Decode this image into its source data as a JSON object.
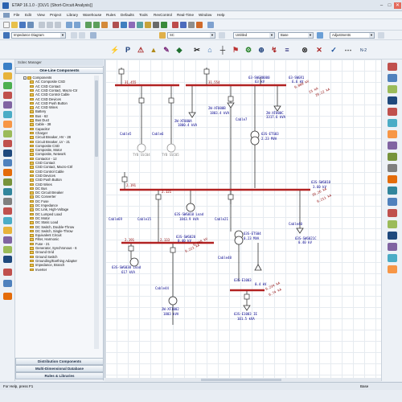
{
  "window": {
    "title": "ETAP 16.1.0 - [OLV1 (Short-Circuit Analysis)]",
    "minimize": "–",
    "maximize": "□",
    "close": "✕"
  },
  "menu": [
    "File",
    "Edit",
    "View",
    "Project",
    "Library",
    "Warehouse",
    "Rules",
    "Defaults",
    "Tools",
    "RevControl",
    "Real-Time",
    "Window",
    "Help"
  ],
  "toolbar": {
    "mode_combo": "Impedance Diagram",
    "study_case_combo": "SC",
    "revision_combo": "Untitled",
    "config_combo": "Base",
    "adjustments_combo": "Adjustments",
    "n2_label": "N-2"
  },
  "panel": {
    "title": "Scitec Manager",
    "header": "One-Line Components",
    "tree_items": [
      "Components",
      "AC Composite CSD",
      "AC CSD Contact",
      "AC CSD Contact, Macro-Ctr",
      "AC CSD Control Cable",
      "AC CSD Devices",
      "AC CSD Push Button",
      "AC CSD Wires",
      "Battery",
      "Bus - 62",
      "Bus Duct",
      "Cable - 38",
      "Capacitor",
      "Charger",
      "Circuit Breaker, HV - 28",
      "Circuit Breaker, LV - 21",
      "Composite CSD",
      "Composite, Motor",
      "Composite, Network",
      "Contactor - 12",
      "CSD Contact",
      "CSD Contact, Macro-Ctrl",
      "CSD Control Cable",
      "CSD Devices",
      "CSD Push Button",
      "CSD Wires",
      "DC Bus",
      "DC Circuit Breaker",
      "DC Converter",
      "DC Fuse",
      "DC Impedance",
      "DC Link, High-Voltage",
      "DC Lumped Load",
      "DC Motor",
      "DC Static Load",
      "DC Switch, Double-Throw",
      "DC Switch, Single-Throw",
      "Equivalent Circuit",
      "Filter, Harmonic",
      "Fuse - 21",
      "Generator, Synchronous - 6",
      "Ground Grid",
      "Ground Switch",
      "Grounding/Earthing Adapter",
      "Impedance, Branch",
      "Inverter"
    ],
    "bottom_buttons": [
      "Distribution Components",
      "Multi-Dimensional Database",
      "Rules & Libraries"
    ]
  },
  "diagram": {
    "labels": [
      {
        "text": "31,455",
        "color": "#8b0000"
      },
      {
        "text": "31,554",
        "color": "#8b0000"
      },
      {
        "text": "63-SWGR0000",
        "color": "#00008b"
      },
      {
        "text": "63 kV",
        "color": "#00008b"
      },
      {
        "text": "63-SWGR1",
        "color": "#00008b"
      },
      {
        "text": "6.6 kV",
        "color": "#00008b"
      },
      {
        "text": "0.000 kV",
        "color": "#8b0000"
      },
      {
        "text": "23 kA",
        "color": "#8b0000"
      },
      {
        "text": "20.22 kA",
        "color": "#8b0000"
      },
      {
        "text": "2W-XF000A",
        "color": "#00008b"
      },
      {
        "text": "2W-XF000B",
        "color": "#00008b"
      },
      {
        "text": "2W-XF000C",
        "color": "#00008b"
      },
      {
        "text": "1800.4 kVA",
        "color": "#00008b"
      },
      {
        "text": "1803.4 kVA",
        "color": "#00008b"
      },
      {
        "text": "3317.6 kVA",
        "color": "#00008b"
      },
      {
        "text": "Cable7",
        "color": "#00008b"
      },
      {
        "text": "Cable5",
        "color": "#00008b"
      },
      {
        "text": "Cable6",
        "color": "#00008b"
      },
      {
        "text": "63S-ETS03",
        "color": "#00008b"
      },
      {
        "text": "2.23 MVA",
        "color": "#00008b"
      },
      {
        "text": "2.191",
        "color": "#8b0000"
      },
      {
        "text": "2.121",
        "color": "#8b0000"
      },
      {
        "text": "63S-SWG010",
        "color": "#00008b"
      },
      {
        "text": "3.60 kV",
        "color": "#00008b"
      },
      {
        "text": "20.26 kA",
        "color": "#8b0000"
      },
      {
        "text": "0.211 kA",
        "color": "#8b0000"
      },
      {
        "text": "63S-SWG010 Load",
        "color": "#00008b"
      },
      {
        "text": "1843.9 kVA",
        "color": "#00008b"
      },
      {
        "text": "Cable69",
        "color": "#00008b"
      },
      {
        "text": "Cable15",
        "color": "#00008b"
      },
      {
        "text": "Cable21",
        "color": "#00008b"
      },
      {
        "text": "63S-SWG020",
        "color": "#00008b"
      },
      {
        "text": "0.40 kV",
        "color": "#00008b"
      },
      {
        "text": "2.191",
        "color": "#8b0000"
      },
      {
        "text": "2.133",
        "color": "#8b0000"
      },
      {
        "text": "0.498 kV",
        "color": "#8b0000"
      },
      {
        "text": "0.221 kA",
        "color": "#8b0000"
      },
      {
        "text": "63S-ETS04",
        "color": "#00008b"
      },
      {
        "text": "0.23 MVA",
        "color": "#00008b"
      },
      {
        "text": "63S-SWG021C",
        "color": "#00008b"
      },
      {
        "text": "0.40 kV",
        "color": "#00008b"
      },
      {
        "text": "Cable40",
        "color": "#00008b"
      },
      {
        "text": "63S-SWG030 Load",
        "color": "#00008b"
      },
      {
        "text": "617 kVA",
        "color": "#00008b"
      },
      {
        "text": "63S-E1003",
        "color": "#00008b"
      },
      {
        "text": "0.4 kV",
        "color": "#00008b"
      },
      {
        "text": "0.234 kA",
        "color": "#8b0000"
      },
      {
        "text": "0.74 kA",
        "color": "#8b0000"
      },
      {
        "text": "Cable44",
        "color": "#00008b"
      },
      {
        "text": "Cable48",
        "color": "#00008b"
      },
      {
        "text": "2W-XF1002",
        "color": "#00008b"
      },
      {
        "text": "1803 kVA",
        "color": "#00008b"
      },
      {
        "text": "63S-E1003 IE",
        "color": "#00008b"
      },
      {
        "text": "101.5 kVA",
        "color": "#00008b"
      },
      {
        "text": "TYB SSC04",
        "color": "#808080"
      },
      {
        "text": "TYB SSC05",
        "color": "#808080"
      }
    ]
  },
  "status": {
    "help": "For Help, press F1",
    "mode": "Base"
  },
  "colors": {
    "bus": "#b22222",
    "wire": "#333333",
    "label_blue": "#00008b",
    "label_red": "#8b0000",
    "accent": "#2b63b0"
  }
}
